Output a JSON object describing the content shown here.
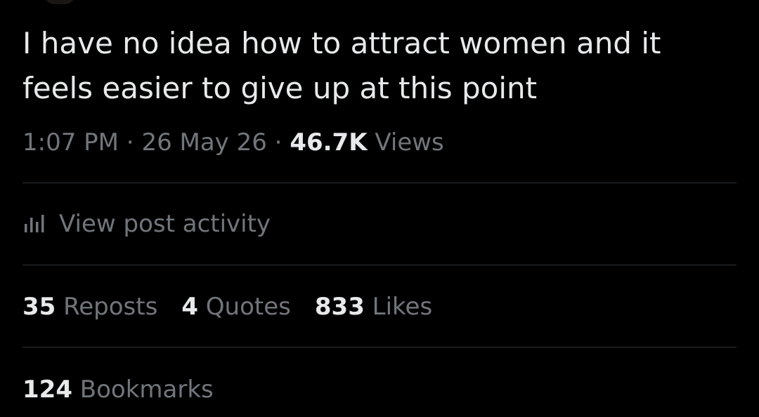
{
  "post": {
    "text": "I have no idea how to attract women and it\nfeels easier to give up at this point",
    "time": "1:07 PM",
    "separator": " · ",
    "date": "26 May 26",
    "views_count": "46.7K",
    "views_label": "Views"
  },
  "activity": {
    "label": "View post activity",
    "icon": "analytics-icon"
  },
  "stats": {
    "reposts_count": "35",
    "reposts_label": "Reposts",
    "quotes_count": "4",
    "quotes_label": "Quotes",
    "likes_count": "833",
    "likes_label": "Likes",
    "bookmarks_count": "124",
    "bookmarks_label": "Bookmarks"
  },
  "colors": {
    "background": "#000000",
    "primary_text": "#e7e9ea",
    "secondary_text": "#71767b",
    "divider": "#2f3336"
  }
}
